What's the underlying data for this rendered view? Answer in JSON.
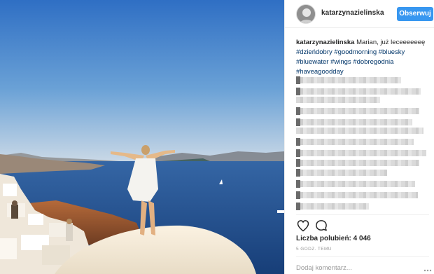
{
  "post": {
    "username": "katarzynazielinska",
    "follow_label": "Obserwuj",
    "caption": {
      "username": "katarzynazielinska",
      "text": " Marian, już leceeeeeeę ",
      "hashtags_line1": "#dzieńdobry #goodmorning #bluesky",
      "hashtags_line2": "#bluewater #wings #dobregodnia",
      "hashtags_line3": "#haveagoodday"
    },
    "likes": "Liczba polubień: 4 046",
    "time": "5 GODZ. TEMU",
    "comment_placeholder": "Dodaj komentarz..."
  },
  "icons": {
    "like": "heart-outline-icon",
    "comment": "comment-bubble-icon",
    "more": "more-dots-icon"
  },
  "colors": {
    "accent": "#3897f0",
    "hashtag": "#003569",
    "muted": "#999999"
  }
}
